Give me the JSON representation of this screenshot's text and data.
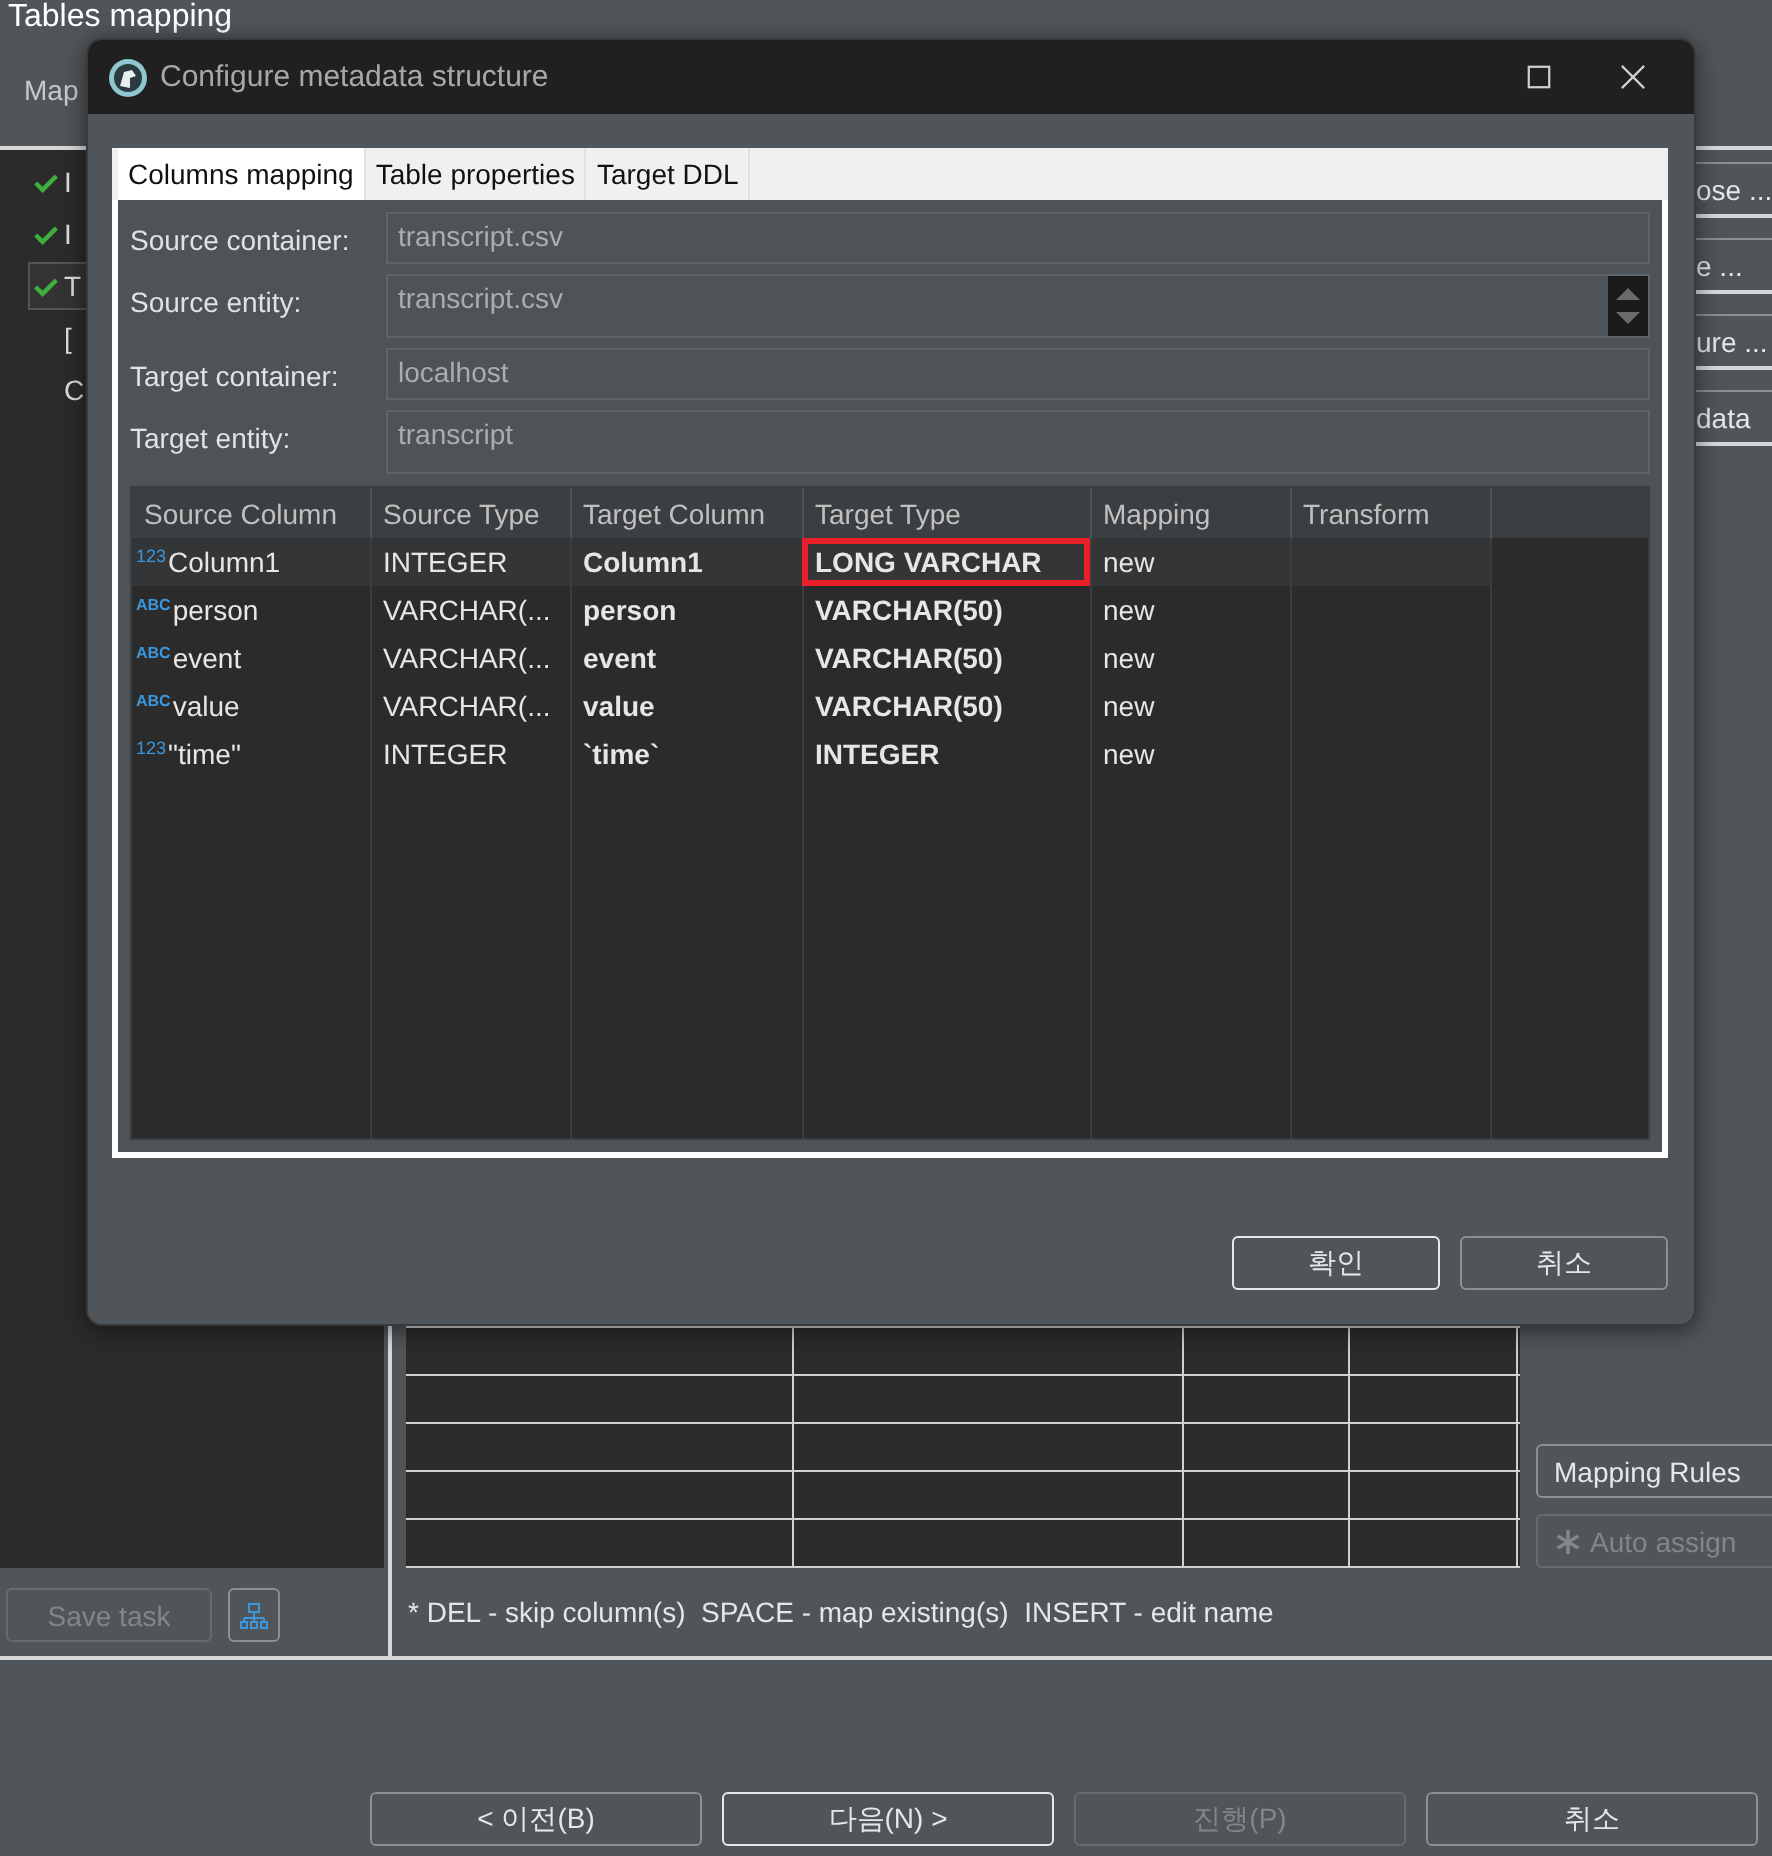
{
  "window": {
    "title": "Tables mapping",
    "subtitle": "Map"
  },
  "tree": [
    {
      "label": "I",
      "checked": true,
      "selected": false
    },
    {
      "label": "I",
      "checked": true,
      "selected": false
    },
    {
      "label": "T",
      "checked": true,
      "selected": true
    },
    {
      "label": "[",
      "checked": false,
      "selected": false
    },
    {
      "label": "C",
      "checked": false,
      "selected": false
    }
  ],
  "side_buttons": [
    "ose ...",
    "e ...",
    "ure ...",
    "data"
  ],
  "mapping_rules_button": {
    "label": "Mapping Rules",
    "disabled": false
  },
  "auto_assign_button": {
    "label": "Auto assign",
    "disabled": true
  },
  "save_task_button": {
    "label": "Save task",
    "disabled": true
  },
  "hint": "* DEL - skip column(s)  SPACE - map existing(s)  INSERT - edit name",
  "nav_buttons": [
    {
      "label": "< 이전(B)",
      "disabled": false,
      "default": false
    },
    {
      "label": "다음(N) >",
      "disabled": false,
      "default": true
    },
    {
      "label": "진행(P)",
      "disabled": true,
      "default": false
    },
    {
      "label": "취소",
      "disabled": false,
      "default": false
    }
  ],
  "dialog": {
    "title": "Configure metadata structure",
    "tabs": [
      {
        "label": "Columns mapping",
        "selected": true
      },
      {
        "label": "Table properties",
        "selected": false
      },
      {
        "label": "Target DDL",
        "selected": false
      }
    ],
    "fields": [
      {
        "label": "Source container:",
        "value": "transcript.csv",
        "kind": "single"
      },
      {
        "label": "Source entity:",
        "value": "transcript.csv",
        "kind": "multi"
      },
      {
        "label": "Target container:",
        "value": "localhost",
        "kind": "single"
      },
      {
        "label": "Target entity:",
        "value": "transcript",
        "kind": "text"
      }
    ],
    "table": {
      "columns": [
        "Source Column",
        "Source Type",
        "Target Column",
        "Target Type",
        "Mapping",
        "Transform"
      ],
      "rows": [
        {
          "type_badge": "123",
          "source_column": "Column1",
          "source_type": "INTEGER",
          "target_column": "Column1",
          "target_type": "LONG VARCHAR",
          "mapping": "new",
          "selected": true,
          "highlighted": true
        },
        {
          "type_badge": "ABC",
          "source_column": "person",
          "source_type": "VARCHAR(...",
          "target_column": "person",
          "target_type": "VARCHAR(50)",
          "mapping": "new",
          "selected": false,
          "highlighted": false
        },
        {
          "type_badge": "ABC",
          "source_column": "event",
          "source_type": "VARCHAR(...",
          "target_column": "event",
          "target_type": "VARCHAR(50)",
          "mapping": "new",
          "selected": false,
          "highlighted": false
        },
        {
          "type_badge": "ABC",
          "source_column": "value",
          "source_type": "VARCHAR(...",
          "target_column": "value",
          "target_type": "VARCHAR(50)",
          "mapping": "new",
          "selected": false,
          "highlighted": false
        },
        {
          "type_badge": "123",
          "source_column": "\"time\"",
          "source_type": "INTEGER",
          "target_column": "`time`",
          "target_type": "INTEGER",
          "mapping": "new",
          "selected": false,
          "highlighted": false
        }
      ]
    },
    "buttons": [
      {
        "label": "확인",
        "default": true
      },
      {
        "label": "취소",
        "default": false
      }
    ]
  }
}
